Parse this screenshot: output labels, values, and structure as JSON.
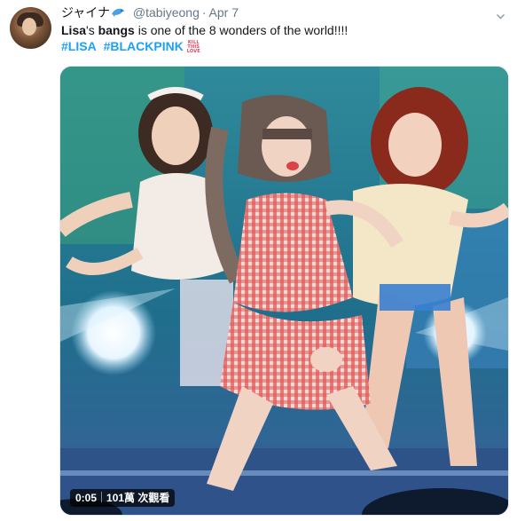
{
  "tweet": {
    "display_name": "ジャイナ",
    "name_emoji": "dolphin-emoji",
    "handle": "@tabiyeong",
    "separator": "·",
    "date": "Apr 7",
    "text_bold_1": "Lisa",
    "text_1": "'s ",
    "text_bold_2": "bangs",
    "text_2": " is one of the 8 wonders of the world!!!!",
    "hashtags": [
      "#LISA",
      "#BLACKPINK"
    ],
    "kill_badge": [
      "KILL",
      "THIS",
      "LOVE"
    ]
  },
  "video": {
    "duration": "0:05",
    "views": "101萬 次觀看"
  },
  "colors": {
    "link": "#1da1f2",
    "secondary_text": "#657786",
    "primary_text": "#14171a",
    "badge_pink": "#e4405f"
  }
}
